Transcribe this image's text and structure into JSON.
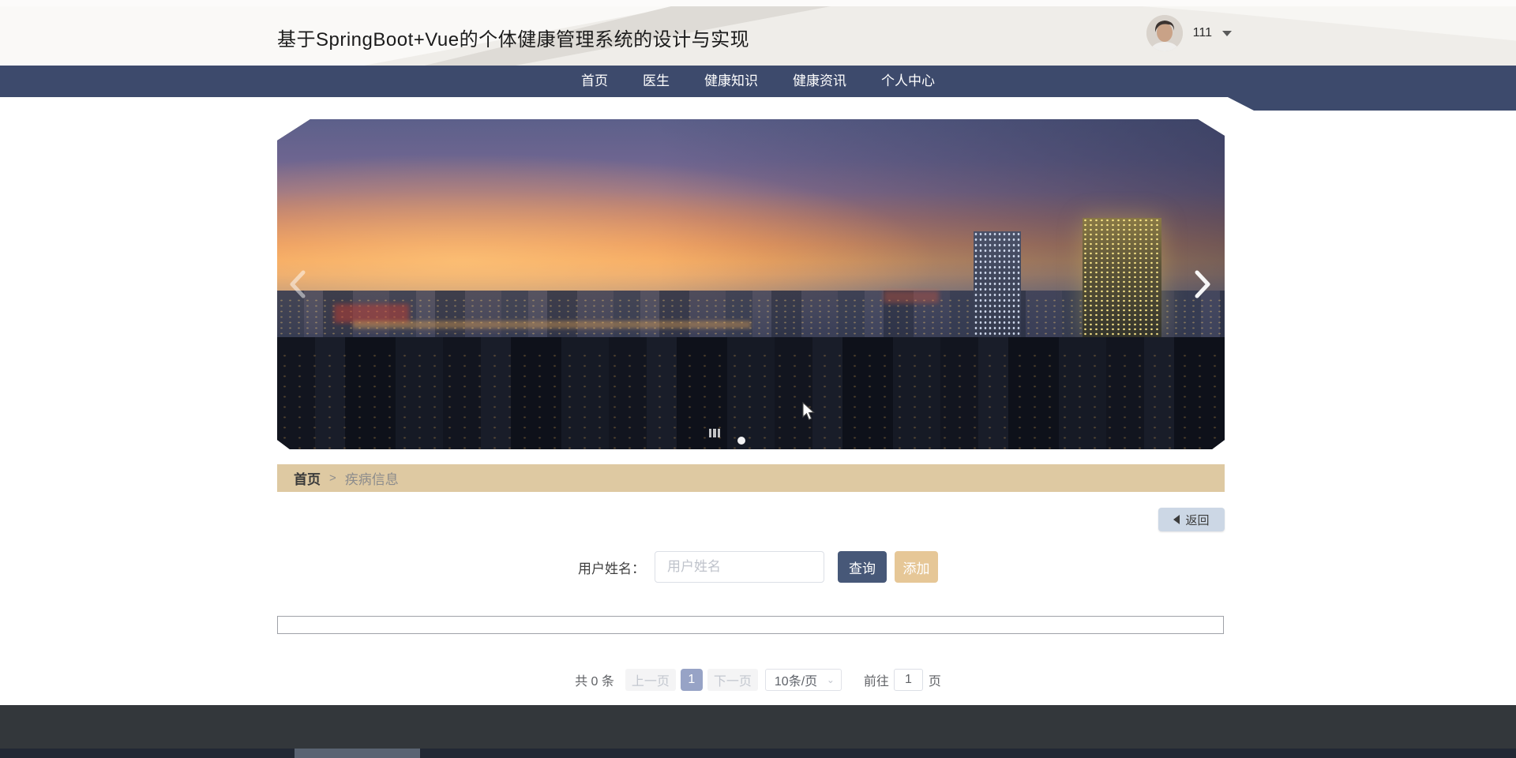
{
  "app": {
    "title": "基于SpringBoot+Vue的个体健康管理系统的设计与实现"
  },
  "header": {
    "username": "111"
  },
  "nav": {
    "items": [
      {
        "label": "首页"
      },
      {
        "label": "医生"
      },
      {
        "label": "健康知识"
      },
      {
        "label": "健康资讯"
      },
      {
        "label": "个人中心"
      }
    ]
  },
  "carousel": {
    "indicators": 1
  },
  "breadcrumb": {
    "home": "首页",
    "separator": ">",
    "current": "疾病信息"
  },
  "actions": {
    "back": "返回"
  },
  "search": {
    "label": "用户姓名：",
    "placeholder": "用户姓名",
    "query": "查询",
    "add": "添加"
  },
  "pagination": {
    "total": "共 0 条",
    "prev": "上一页",
    "page": "1",
    "next": "下一页",
    "size": "10条/页",
    "goto": "前往",
    "goto_value": "1",
    "unit": "页"
  },
  "colors": {
    "nav_bg": "#3D4A6C",
    "breadcrumb_bg": "#DEC9A2",
    "query_button": "#475878",
    "add_button": "#E6C797",
    "back_button": "#CCD7E5",
    "active_page": "#97A3C6",
    "footer": "#33373B"
  }
}
